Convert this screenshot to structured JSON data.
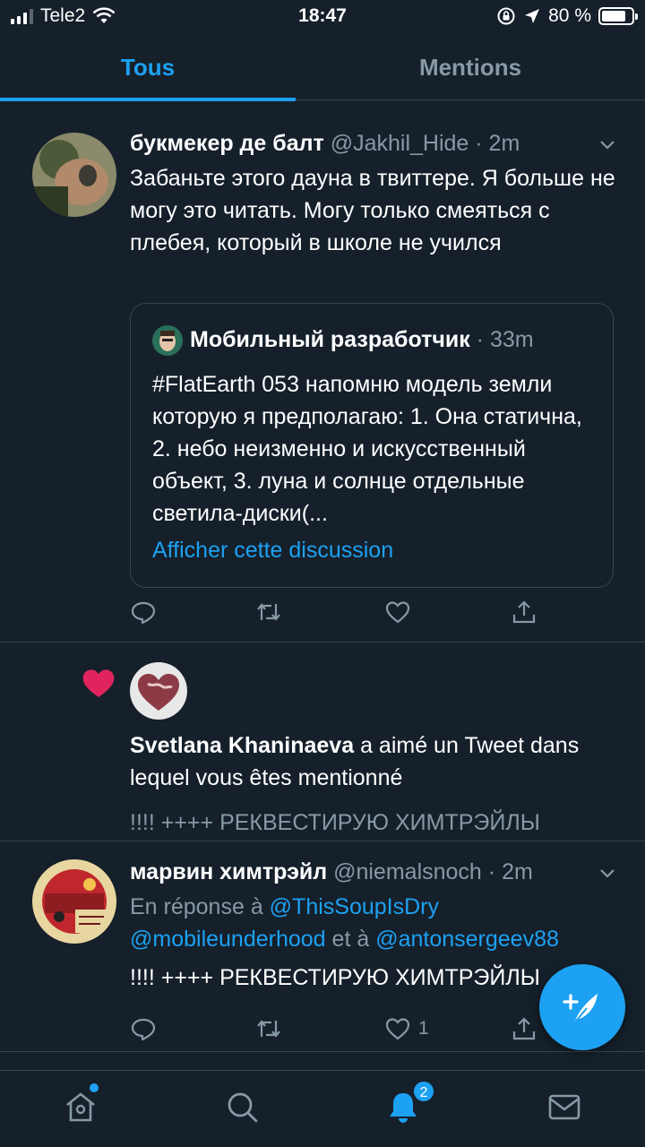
{
  "status_bar": {
    "carrier": "Tele2",
    "time": "18:47",
    "battery": "80 %",
    "battery_level": 0.8
  },
  "tabs": [
    {
      "label": "Tous",
      "active": true
    },
    {
      "label": "Mentions",
      "active": false
    }
  ],
  "tweet1": {
    "name": "букмекер де балт",
    "handle": "@Jakhil_Hide",
    "time": "2m",
    "text": "Забаньте этого дауна в твиттере. Я больше не могу это читать. Могу только смеяться с плебея, который в школе не учился",
    "quote": {
      "name": "Мобильный разработчик",
      "time": "33m",
      "text": "#FlatEarth 053 напомню модель земли которую я предполагаю: 1. Она статична, 2. небо неизменно и искусственный объект, 3. луна и солнце отдельные светила-диски(...",
      "show_thread": "Afficher cette discussion"
    }
  },
  "like_notification": {
    "name": "Svetlana Khaninaeva",
    "action": " a aimé un Tweet dans lequel vous êtes mentionné",
    "preview": "!!!! ++++ РЕКВЕСТИРУЮ ХИМТРЭЙЛЫ"
  },
  "tweet2": {
    "name": "марвин химтрэйл",
    "handle": "@niemalsnoch",
    "time": "2m",
    "reply_prefix": "En réponse à ",
    "reply_user1": "@ThisSoupIsDry",
    "reply_user2": "@mobileunderhood",
    "reply_and": " et à ",
    "reply_user3": "@antonsergeev88",
    "text": "!!!! ++++ РЕКВЕСТИРУЮ ХИМТРЭЙЛЫ",
    "like_count": "1"
  },
  "bottom_nav": {
    "notifications_badge": "2"
  },
  "colors": {
    "background": "#15202b",
    "accent": "#1da1f2",
    "muted": "#8899a6",
    "heart": "#e0245e",
    "divider": "#38444d"
  }
}
